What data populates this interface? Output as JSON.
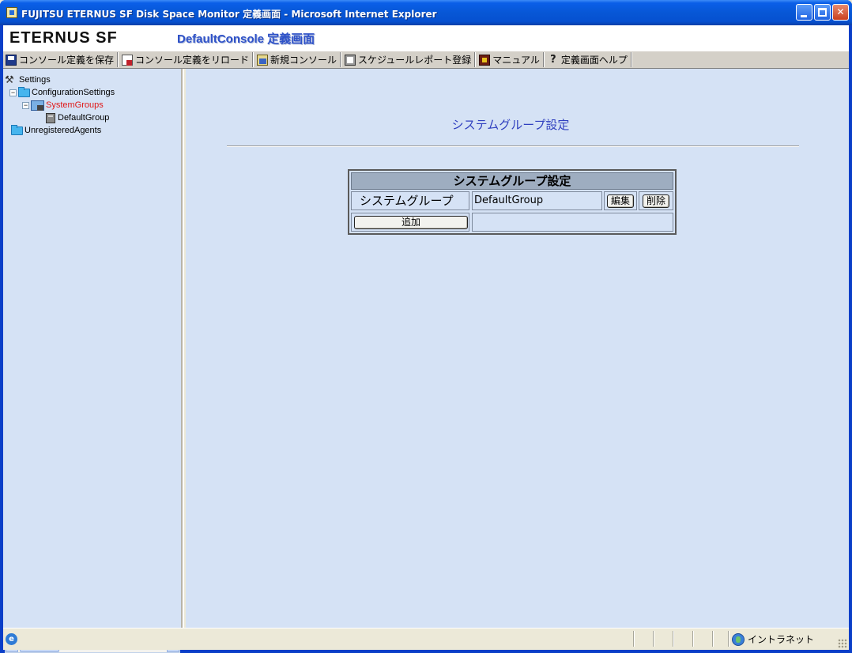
{
  "window": {
    "title": "FUJITSU ETERNUS SF Disk Space Monitor 定義画面 - Microsoft Internet Explorer",
    "controls": {
      "minimize": "",
      "maximize": "",
      "close": "✕"
    }
  },
  "header": {
    "logo": "ETERNUS SF",
    "console_title": "DefaultConsole 定義画面"
  },
  "toolbar": {
    "items": [
      {
        "label": "コンソール定義を保存",
        "icon": "save-icon"
      },
      {
        "label": "コンソール定義をリロード",
        "icon": "reload-icon"
      },
      {
        "label": "新規コンソール",
        "icon": "new-console-icon"
      },
      {
        "label": "スケジュールレポート登録",
        "icon": "schedule-report-icon"
      },
      {
        "label": "マニュアル",
        "icon": "manual-icon"
      },
      {
        "label": "定義画面ヘルプ",
        "icon": "help-icon"
      }
    ]
  },
  "tree": {
    "root": "Settings",
    "configuration": "ConfigurationSettings",
    "system_groups": "SystemGroups",
    "default_group": "DefaultGroup",
    "unregistered": "UnregisteredAgents",
    "selected_color": "#e01818",
    "expander_minus": "−"
  },
  "main": {
    "heading": "システムグループ設定",
    "table": {
      "header": "システムグループ設定",
      "row_label": "システムグループ",
      "row_value": "DefaultGroup",
      "edit_button": "編集",
      "delete_button": "削除",
      "add_button": "追加"
    }
  },
  "scrollbar": {
    "left_arrow": "◀",
    "right_arrow": "▶"
  },
  "statusbar": {
    "ie_glyph": "e",
    "zone": "イントラネット"
  },
  "colors": {
    "title_bar": "#0757d6",
    "content_bg": "#d5e2f5",
    "heading": "#2f3fbf",
    "selected": "#e01818"
  }
}
